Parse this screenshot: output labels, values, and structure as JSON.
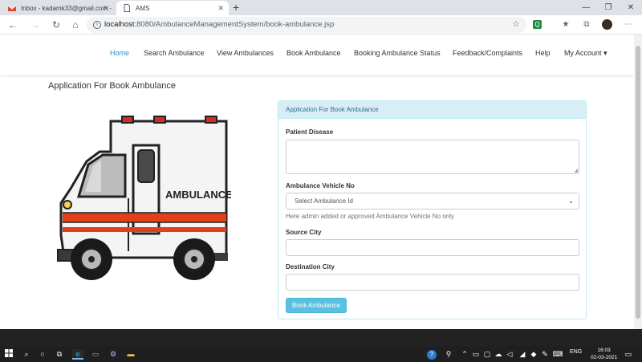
{
  "browser": {
    "tabs": [
      {
        "title": "Inbox - kadamk33@gmail.com -",
        "active": false
      },
      {
        "title": "AMS",
        "active": true
      }
    ],
    "url_host": "localhost",
    "url_path": ":8080/AmbulanceManagementSystem/book-ambulance.jsp",
    "new_tab_icon": "plus-icon",
    "extension_badge": "Q"
  },
  "navbar": {
    "items": [
      {
        "label": "Home",
        "active": true
      },
      {
        "label": "Search Ambulance"
      },
      {
        "label": "View Ambulances"
      },
      {
        "label": "Book Ambulance"
      },
      {
        "label": "Booking Ambulance Status"
      },
      {
        "label": "Feedback/Complaints"
      },
      {
        "label": "Help"
      },
      {
        "label": "My Account ▾"
      }
    ]
  },
  "page": {
    "heading": "Application For Book Ambulance",
    "illustration_text": "AMBULANCE"
  },
  "form": {
    "panel_title": "Application For Book Ambulance",
    "patient_disease_label": "Patient Disease",
    "vehicle_label": "Ambulance Vehicle No",
    "vehicle_selected": "Select Ambulance Id",
    "vehicle_help": "Here admin added or approved Ambulance Vehicle No only",
    "source_label": "Source City",
    "destination_label": "Destination City",
    "submit_label": "Book Ambulance"
  },
  "taskbar": {
    "language": "ENG",
    "time": "16:03",
    "date": "02-03-2021"
  },
  "colors": {
    "link_active": "#2a93c9",
    "panel_head_bg": "#d9edf7",
    "button_bg": "#5bc0de"
  }
}
